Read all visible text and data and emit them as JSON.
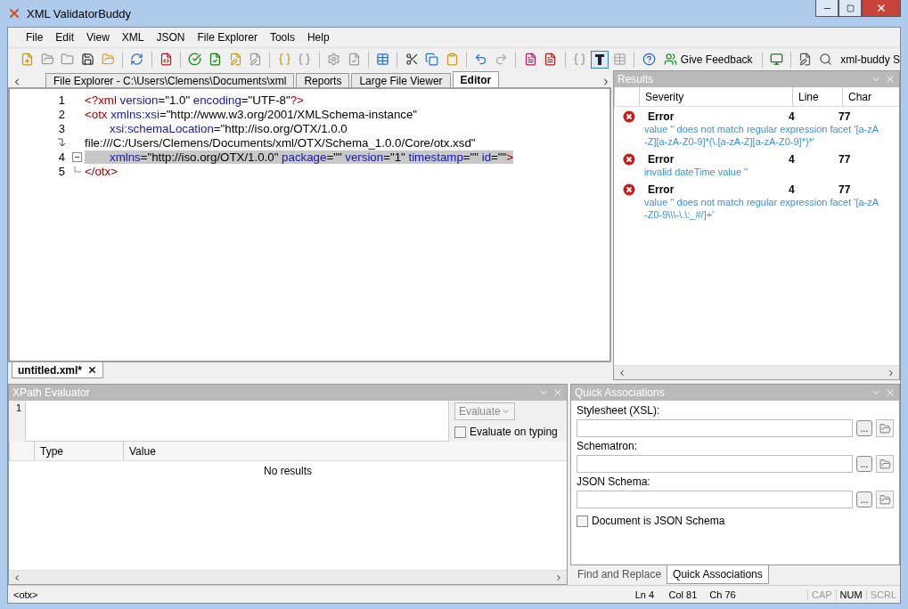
{
  "window": {
    "title": "XML ValidatorBuddy"
  },
  "menu": [
    "File",
    "Edit",
    "View",
    "XML",
    "JSON",
    "File Explorer",
    "Tools",
    "Help"
  ],
  "toolbar": {
    "feedback_button": "Give Feedback",
    "product_label": "xml-buddy S",
    "text_mode_pressed": true
  },
  "editor_tabs": [
    {
      "label": "File Explorer - C:\\Users\\Clemens\\Documents\\xml",
      "selected": false
    },
    {
      "label": "Reports",
      "selected": false
    },
    {
      "label": "Large File Viewer",
      "selected": false
    },
    {
      "label": "Editor",
      "selected": true
    }
  ],
  "code_lines": [
    {
      "kind": "line",
      "number": "1",
      "highlighted": false,
      "fold_start": false,
      "fold_end": false,
      "indent": false,
      "tokens": [
        {
          "kind": "tag",
          "text": "<?xml "
        },
        {
          "kind": "attr",
          "text": "version"
        },
        {
          "kind": "text",
          "text": "=\"1.0\" "
        },
        {
          "kind": "attr",
          "text": "encoding"
        },
        {
          "kind": "text",
          "text": "=\"UTF-8\""
        },
        {
          "kind": "tag",
          "text": "?>"
        }
      ]
    },
    {
      "kind": "line",
      "number": "2",
      "highlighted": false,
      "fold_start": false,
      "fold_end": false,
      "indent": false,
      "tokens": [
        {
          "kind": "tag",
          "text": "<otx "
        },
        {
          "kind": "attr",
          "text": "xmlns:xsi"
        },
        {
          "kind": "text",
          "text": "=\"http://www.w3.org/2001/XMLSchema-instance\""
        }
      ]
    },
    {
      "kind": "line",
      "number": "3",
      "highlighted": false,
      "fold_start": false,
      "fold_end": false,
      "indent": true,
      "tokens": [
        {
          "kind": "attr",
          "text": "xsi:schemaLocation"
        },
        {
          "kind": "text",
          "text": "=\"http://iso.org/OTX/1.0.0"
        }
      ]
    },
    {
      "kind": "wrap",
      "highlighted": false,
      "fold_start": false,
      "fold_end": false,
      "indent": false,
      "tokens": [
        {
          "kind": "text",
          "text": "file:///C:/Users/Clemens/Documents/xml/OTX/Schema_1.0.0/Core/otx.xsd\""
        }
      ]
    },
    {
      "kind": "line",
      "number": "4",
      "highlighted": true,
      "fold_start": true,
      "fold_end": false,
      "indent": true,
      "tokens": [
        {
          "kind": "attr",
          "text": "xmlns"
        },
        {
          "kind": "text",
          "text": "=\"http://iso.org/OTX/1.0.0\" "
        },
        {
          "kind": "attr",
          "text": "package"
        },
        {
          "kind": "text",
          "text": "=\"\" "
        },
        {
          "kind": "attr",
          "text": "version"
        },
        {
          "kind": "text",
          "text": "=\"1\" "
        },
        {
          "kind": "attr",
          "text": "timestamp"
        },
        {
          "kind": "text",
          "text": "=\"\" "
        },
        {
          "kind": "attr",
          "text": "id"
        },
        {
          "kind": "text",
          "text": "=\"\""
        },
        {
          "kind": "tag",
          "text": ">"
        }
      ]
    },
    {
      "kind": "line",
      "number": "5",
      "highlighted": false,
      "fold_start": false,
      "fold_end": true,
      "indent": false,
      "tokens": [
        {
          "kind": "tag",
          "text": "</otx>"
        }
      ]
    }
  ],
  "document_tabs": [
    {
      "label": "untitled.xml*",
      "selected": true
    }
  ],
  "results": {
    "title": "Results",
    "columns": [
      "Severity",
      "Line",
      "Char"
    ],
    "rows": [
      {
        "severity": "Error",
        "line": "4",
        "char": "77",
        "message": "value '' does not match regular expression facet '[a-zA-Z][a-zA-Z0-9]*(\\.[a-zA-Z][a-zA-Z0-9]*)*'"
      },
      {
        "severity": "Error",
        "line": "4",
        "char": "77",
        "message": "invalid dateTime value ''"
      },
      {
        "severity": "Error",
        "line": "4",
        "char": "77",
        "message": "value '' does not match regular expression facet '[a-zA-Z0-9\\\\\\-\\.\\:_#/]+'"
      }
    ]
  },
  "xpath": {
    "title": "XPath Evaluator",
    "line_number": "1",
    "evaluate_button": "Evaluate",
    "evaluate_on_typing": {
      "label": "Evaluate on typing",
      "checked": false
    },
    "columns": [
      "Type",
      "Value"
    ],
    "empty_text": "No results"
  },
  "quick_associations": {
    "title": "Quick Associations",
    "fields": [
      {
        "label": "Stylesheet (XSL):"
      },
      {
        "label": "Schematron:"
      },
      {
        "label": "JSON Schema:"
      }
    ],
    "browse_button": "...",
    "json_schema_checkbox": {
      "label": "Document is JSON Schema",
      "checked": false
    }
  },
  "bottom_tabs": [
    {
      "label": "Find and Replace",
      "selected": false
    },
    {
      "label": "Quick Associations",
      "selected": true
    }
  ],
  "status_bar": {
    "path": "<otx>",
    "line": "Ln 4",
    "column": "Col 81",
    "char": "Ch 76",
    "indicators": [
      {
        "label": "CAP",
        "on": false
      },
      {
        "label": "NUM",
        "on": true
      },
      {
        "label": "SCRL",
        "on": false
      }
    ]
  }
}
